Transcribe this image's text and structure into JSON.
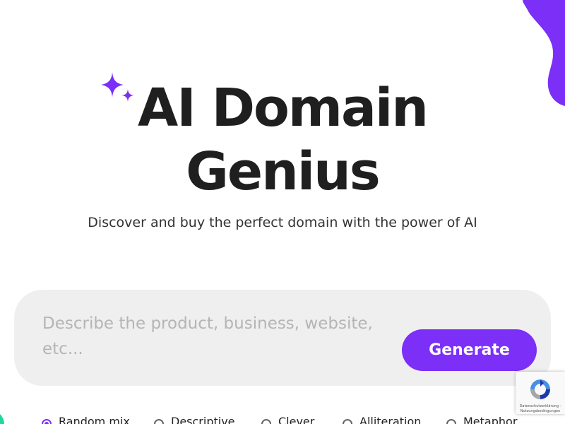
{
  "hero": {
    "title_line1": "AI Domain",
    "title_line2": "Genius",
    "subtitle": "Discover and buy the perfect domain with the power of AI"
  },
  "search": {
    "placeholder": "Describe the product, business, website, etc...",
    "value": "",
    "generate_label": "Generate"
  },
  "style_options": [
    {
      "label": "Random mix",
      "selected": true
    },
    {
      "label": "Descriptive",
      "selected": false
    },
    {
      "label": "Clever",
      "selected": false
    },
    {
      "label": "Alliteration",
      "selected": false
    },
    {
      "label": "Metaphor",
      "selected": false
    }
  ],
  "recaptcha": {
    "privacy_label": "Datenschutzerklärung",
    "separator": " - ",
    "terms_label": "Nutzungsbedingungen"
  },
  "colors": {
    "accent": "#7b2ff7",
    "title": "#1f1f1f",
    "search_bg": "#efefef",
    "corner_accent": "#1ed8a0"
  },
  "icons": {
    "sparkle": "sparkle-icon",
    "recaptcha": "recaptcha-logo-icon"
  }
}
